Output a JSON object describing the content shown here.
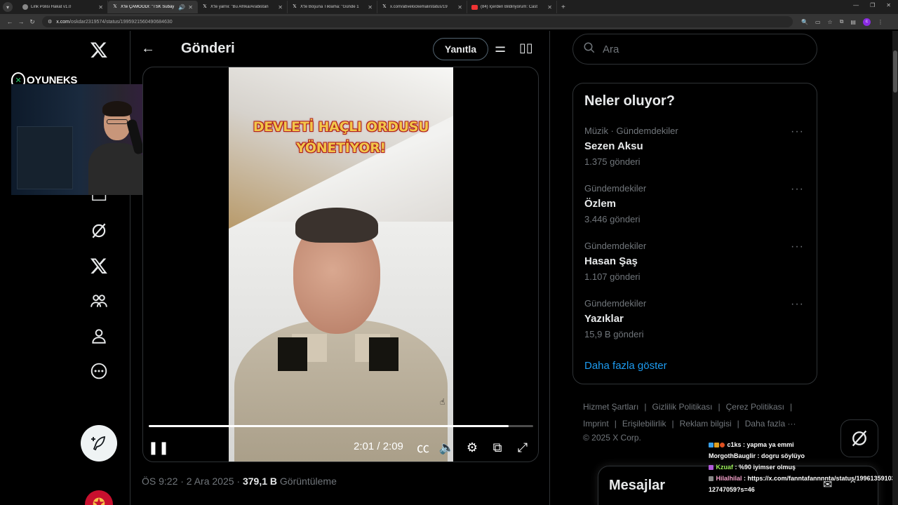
{
  "browser": {
    "tabs": [
      {
        "title": "Link Polisi Hakat v1.0",
        "favicon": "page-icon",
        "active": false
      },
      {
        "title": "X'te ÇAMOODI: \"TSK Subay",
        "favicon": "x-icon",
        "active": true
      },
      {
        "title": "X'te yarnii: \"Bu Afrika/Arabistan",
        "favicon": "x-icon",
        "active": false
      },
      {
        "title": "X'te Boşuna Tıklama: \"Günde 1",
        "favicon": "x-icon",
        "active": false
      },
      {
        "title": "x.com/abvelockemali/status/19",
        "favicon": "x-icon",
        "active": false
      },
      {
        "title": "(84) İçerden Bildiriyorum: Cast",
        "favicon": "youtube-icon",
        "active": false
      }
    ],
    "url_host": "x.com",
    "url_path": "/oskdar2319574/status/1995921560490684630"
  },
  "stream": {
    "brand": "OYUNEKS"
  },
  "main": {
    "title": "Gönderi",
    "reply_label": "Yanıtla",
    "video": {
      "overlay_text_1": "DEVLETİ HAÇLI ORDUSU",
      "overlay_text_2": "YÖNETİYOR!",
      "time": "2:01 / 2:09",
      "progress": 0.937
    },
    "meta_time": "ÖS 9:22 · 2 Ara 2025 · ",
    "views": "379,1 B",
    "views_label": " Görüntüleme"
  },
  "sidebar": {
    "search_placeholder": "Ara",
    "trends_title": "Neler oluyor?",
    "trends": [
      {
        "category": "Müzik · Gündemdekiler",
        "name": "Sezen Aksu",
        "count": "1.375 gönderi"
      },
      {
        "category": "Gündemdekiler",
        "name": "Özlem",
        "count": "3.446 gönderi"
      },
      {
        "category": "Gündemdekiler",
        "name": "Hasan Şaş",
        "count": "1.107 gönderi"
      },
      {
        "category": "Gündemdekiler",
        "name": "Yazıklar",
        "count": "15,9 B gönderi"
      }
    ],
    "show_more": "Daha fazla göster",
    "footer": {
      "terms": "Hizmet Şartları",
      "privacy": "Gizlilik Politikası",
      "cookies": "Çerez Politikası",
      "imprint": "Imprint",
      "accessibility": "Erişilebilirlik",
      "ads": "Reklam bilgisi",
      "more": "Daha fazla ···",
      "copyright": "© 2025 X Corp."
    },
    "messages_title": "Mesajlar"
  },
  "chat": [
    {
      "user": "c1ks",
      "user_color": "#ffffff",
      "message": "yapma ya emmi"
    },
    {
      "user": "MorgothBauglir",
      "user_color": "#ffffff",
      "message": "dogru söylüyo"
    },
    {
      "user": "Kzuaf",
      "user_color": "#9ef25b",
      "message": "%90 iyimser olmuş"
    },
    {
      "user": "Hilalhilal",
      "user_color": "#f2a0c8",
      "message": "https://x.com/fanntafannnnta/status/1996135910312747059?s=46"
    }
  ],
  "colors": {
    "accent": "#1d9bf0",
    "border": "#2f3336",
    "muted": "#71767b",
    "overlay_text": "#f2c64a"
  }
}
